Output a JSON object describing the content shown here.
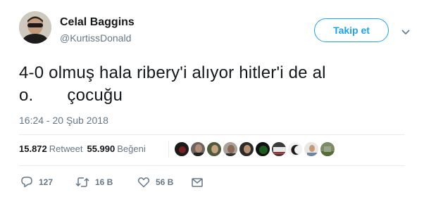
{
  "user": {
    "display_name": "Celal Baggins",
    "handle": "@KurtissDonald"
  },
  "follow_button": {
    "label": "Takip et"
  },
  "tweet": {
    "line1": "4-0 olmuş hala ribery'i alıyor hitler'i de al",
    "line2_start": "o.",
    "line2_end": "çocuğu",
    "timestamp": "16:24 - 20 Şub 2018"
  },
  "stats": {
    "retweets": "15.872",
    "retweets_label": "Retweet",
    "likes": "55.990",
    "likes_label": "Beğeni"
  },
  "actions": {
    "reply_count": "127",
    "retweet_count": "16 B",
    "like_count": "56 B"
  },
  "colors": {
    "accent": "#1da1f2",
    "text": "#14171a",
    "secondary": "#657786",
    "divider": "#e6ecf0"
  },
  "icons": [
    "reply-icon",
    "retweet-icon",
    "heart-icon",
    "message-icon",
    "chevron-down-icon"
  ]
}
